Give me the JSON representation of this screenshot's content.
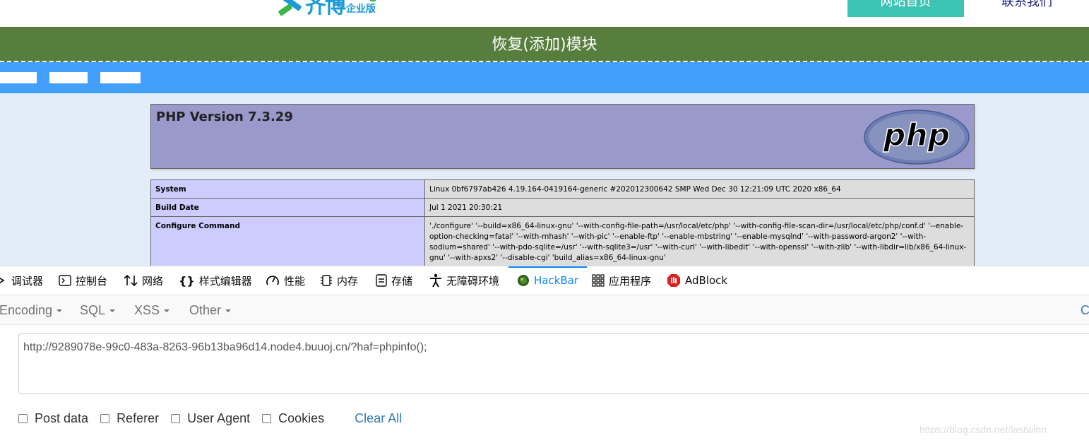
{
  "site": {
    "logo_text": "齐博",
    "logo_edition": "企业版",
    "home_button": "网站首页",
    "contact_link": "联系我们",
    "banner_title": "恢复(添加)模块"
  },
  "phpinfo": {
    "title": "PHP Version 7.3.29",
    "logo_text": "php",
    "rows": [
      {
        "key": "System",
        "value": "Linux 0bf6797ab426 4.19.164-0419164-generic #202012300642 SMP Wed Dec 30 12:21:09 UTC 2020 x86_64"
      },
      {
        "key": "Build Date",
        "value": "Jul 1 2021 20:30:21"
      },
      {
        "key": "Configure Command",
        "value": "'./configure' '--build=x86_64-linux-gnu' '--with-config-file-path=/usr/local/etc/php' '--with-config-file-scan-dir=/usr/local/etc/php/conf.d' '--enable-option-checking=fatal' '--with-mhash' '--with-pic' '--enable-ftp' '--enable-mbstring' '--enable-mysqlnd' '--with-password-argon2' '--with-sodium=shared' '--with-pdo-sqlite=/usr' '--with-sqlite3=/usr' '--with-curl' '--with-libedit' '--with-openssl' '--with-zlib' '--with-libdir=lib/x86_64-linux-gnu' '--with-apxs2' '--disable-cgi' 'build_alias=x86_64-linux-gnu'"
      }
    ]
  },
  "devtools": {
    "tabs": [
      {
        "label": "调试器",
        "icon": "debugger-icon"
      },
      {
        "label": "控制台",
        "icon": "console-icon"
      },
      {
        "label": "网络",
        "icon": "network-icon"
      },
      {
        "label": "样式编辑器",
        "icon": "style-editor-icon"
      },
      {
        "label": "性能",
        "icon": "performance-icon"
      },
      {
        "label": "内存",
        "icon": "memory-icon"
      },
      {
        "label": "存储",
        "icon": "storage-icon"
      },
      {
        "label": "无障碍环境",
        "icon": "accessibility-icon"
      },
      {
        "label": "HackBar",
        "icon": "hackbar-icon"
      },
      {
        "label": "应用程序",
        "icon": "application-icon"
      },
      {
        "label": "AdBlock",
        "icon": "adblock-icon"
      }
    ],
    "active_tab": "HackBar"
  },
  "hackbar": {
    "menus": [
      "Encoding",
      "SQL",
      "XSS",
      "Other"
    ],
    "right_cut": "C",
    "url": "http://9289078e-99c0-483a-8263-96b13ba96d14.node4.buuoj.cn/?haf=phpinfo();",
    "options": [
      "Post data",
      "Referer",
      "User Agent",
      "Cookies"
    ],
    "clear_all": "Clear All"
  },
  "watermark": "https://blog.csdn.net/lastwinn",
  "colors": {
    "banner": "#587e3e",
    "bluebar": "#429ffc",
    "php_header": "#9999cc",
    "accent": "#0a84ff"
  }
}
